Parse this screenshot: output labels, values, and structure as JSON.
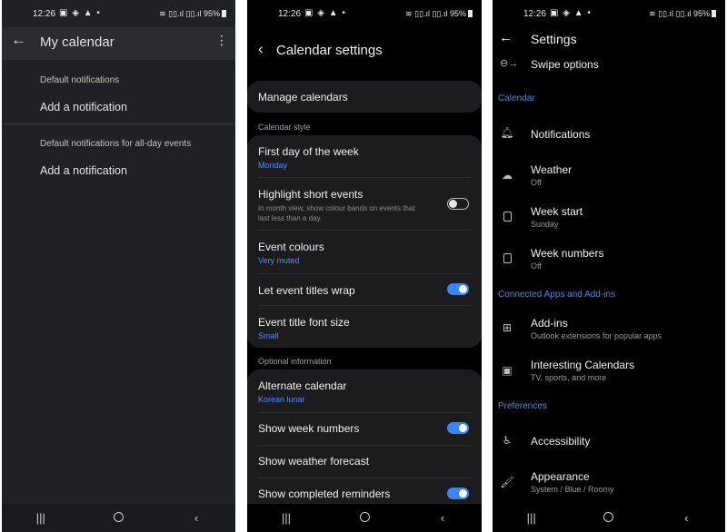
{
  "status": {
    "time": "12:26",
    "left_icons": "▣ ◈ ▲ •",
    "right_icons": "≋ ▯▯.ıl ▯▯.ıl",
    "battery": "95%"
  },
  "nav": {
    "recents": "|||",
    "back": "‹"
  },
  "panel1": {
    "title": "My calendar",
    "default_notifications_label": "Default notifications",
    "add_notification_1": "Add a notification",
    "allday_notifications_label": "Default notifications for all-day events",
    "add_notification_2": "Add a notification"
  },
  "panel2": {
    "title": "Calendar settings",
    "manage_calendars": "Manage calendars",
    "section_style": "Calendar style",
    "first_day_title": "First day of the week",
    "first_day_value": "Monday",
    "highlight_title": "Highlight short events",
    "highlight_desc": "In month view, show colour bands on events that last less than a day.",
    "highlight_on": false,
    "event_colours_title": "Event colours",
    "event_colours_value": "Very muted",
    "wrap_title": "Let event titles wrap",
    "wrap_on": true,
    "font_size_title": "Event title font size",
    "font_size_value": "Small",
    "section_optional": "Optional information",
    "alt_cal_title": "Alternate calendar",
    "alt_cal_value": "Korean lunar",
    "week_numbers_title": "Show week numbers",
    "week_numbers_on": true,
    "weather_title": "Show weather forecast",
    "completed_title": "Show completed reminders",
    "completed_on": true
  },
  "panel3": {
    "title": "Settings",
    "swipe": "Swipe options",
    "section_calendar": "Calendar",
    "notifications": "Notifications",
    "weather_title": "Weather",
    "weather_value": "Off",
    "week_start_title": "Week start",
    "week_start_value": "Sunday",
    "week_numbers_title": "Week numbers",
    "week_numbers_value": "Off",
    "section_connected": "Connected Apps and Add-ins",
    "addins_title": "Add-ins",
    "addins_sub": "Outlook extensions for popular apps",
    "interesting_title": "Interesting Calendars",
    "interesting_sub": "TV, sports, and more",
    "section_prefs": "Preferences",
    "accessibility": "Accessibility",
    "appearance_title": "Appearance",
    "appearance_sub": "System / Blue / Roomy"
  },
  "colors": {
    "accent_blue": "#3e82f7",
    "section_blue": "#4a8cd9"
  }
}
